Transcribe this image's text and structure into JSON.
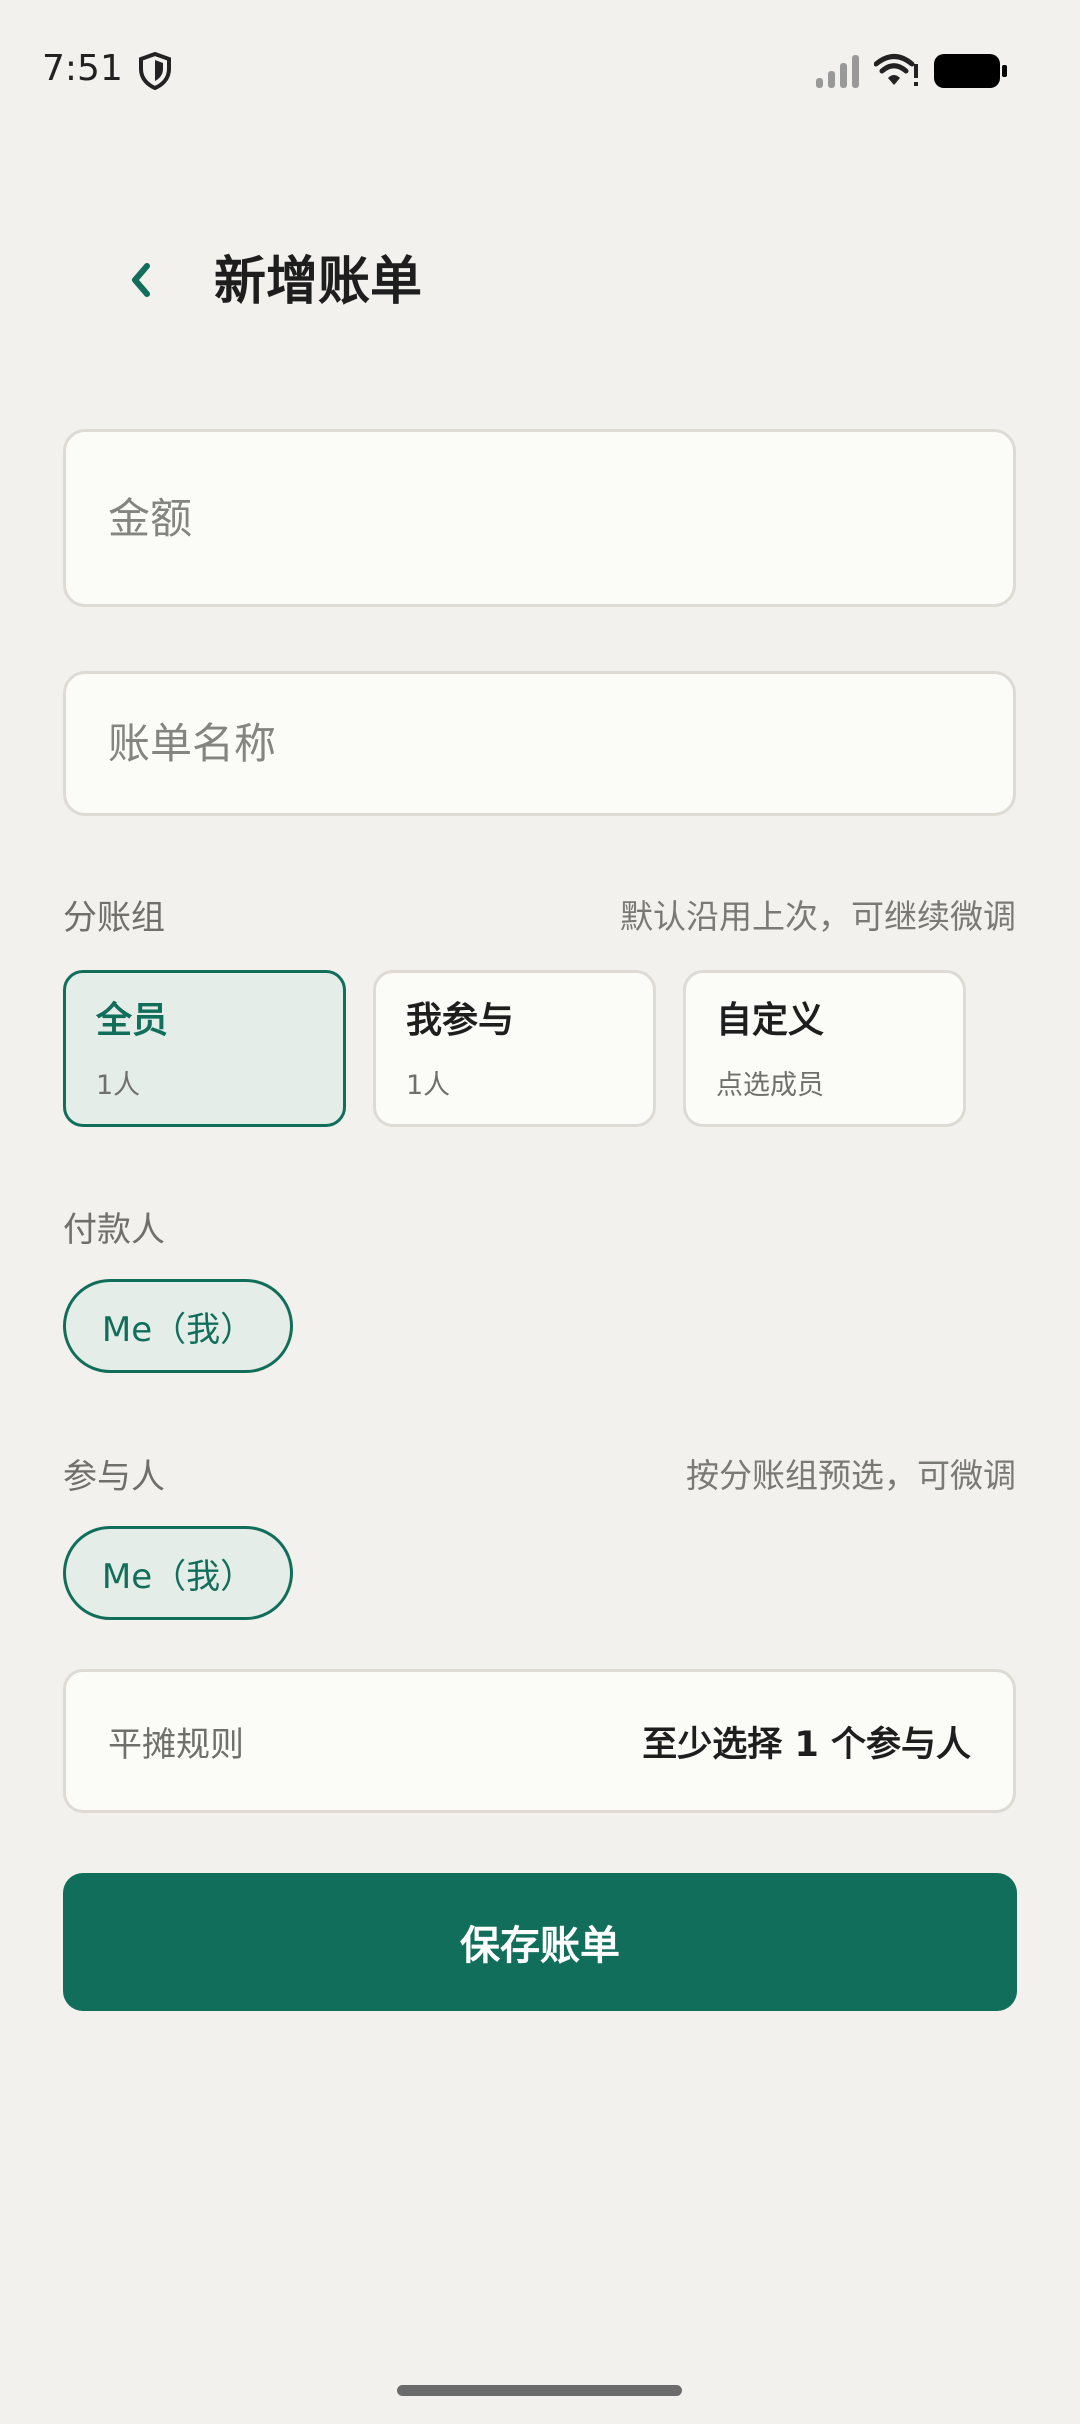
{
  "status_bar": {
    "time": "7:51",
    "icons": [
      "shield-icon",
      "signal-icon",
      "wifi-icon",
      "battery-icon"
    ]
  },
  "header": {
    "back_icon": "chevron-left-icon",
    "title": "新增账单"
  },
  "form": {
    "amount_placeholder": "金额",
    "amount_value": "",
    "name_placeholder": "账单名称",
    "name_value": ""
  },
  "split_group": {
    "label": "分账组",
    "hint": "默认沿用上次，可继续微调",
    "options": [
      {
        "title": "全员",
        "subtitle": "1人",
        "selected": true
      },
      {
        "title": "我参与",
        "subtitle": "1人",
        "selected": false
      },
      {
        "title": "自定义",
        "subtitle": "点选成员",
        "selected": false
      }
    ]
  },
  "payer": {
    "label": "付款人",
    "chips": [
      {
        "label": "Me（我）",
        "selected": true
      }
    ]
  },
  "participants": {
    "label": "参与人",
    "hint": "按分账组预选，可微调",
    "chips": [
      {
        "label": "Me（我）",
        "selected": true
      }
    ]
  },
  "split_rule": {
    "label": "平摊规则",
    "value": "至少选择 1 个参与人"
  },
  "save_button_label": "保存账单",
  "colors": {
    "accent": "#116E5A",
    "accent_light": "#E5EDE8",
    "background": "#F2F1ED",
    "card": "#FBFBF8"
  }
}
